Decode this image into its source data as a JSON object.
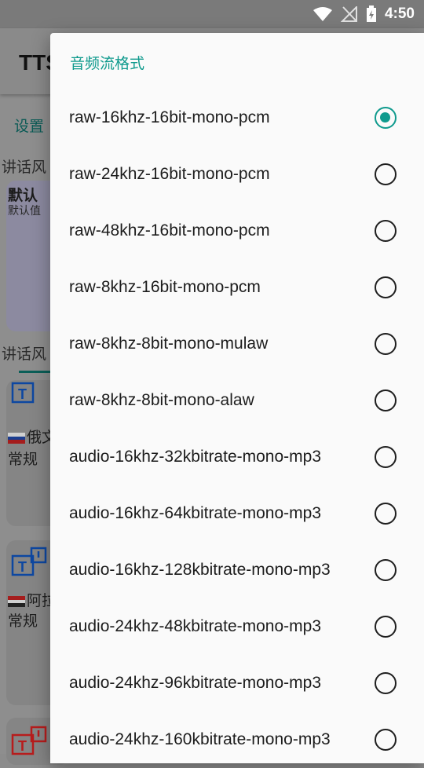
{
  "status_bar": {
    "time": "4:50"
  },
  "background": {
    "title": "TTS",
    "settings_label": "设置",
    "speak_style_label": "讲话风",
    "default_card": {
      "title": "默认",
      "subtitle": "默认值"
    },
    "speak_role_label": "讲话风",
    "voice_cards": [
      {
        "name": "俄文",
        "desc": "常规",
        "flag": "ru",
        "icon_color": "#1565c0"
      },
      {
        "name": "阿拉",
        "desc": "常规",
        "flag": "eg",
        "icon_color": "#1565c0"
      },
      {
        "name": "",
        "desc": "",
        "flag": "",
        "icon_color": "#c62828"
      }
    ]
  },
  "dialog": {
    "title": "音频流格式",
    "options": [
      {
        "label": "raw-16khz-16bit-mono-pcm",
        "checked": true
      },
      {
        "label": "raw-24khz-16bit-mono-pcm",
        "checked": false
      },
      {
        "label": "raw-48khz-16bit-mono-pcm",
        "checked": false
      },
      {
        "label": "raw-8khz-16bit-mono-pcm",
        "checked": false
      },
      {
        "label": "raw-8khz-8bit-mono-mulaw",
        "checked": false
      },
      {
        "label": "raw-8khz-8bit-mono-alaw",
        "checked": false
      },
      {
        "label": "audio-16khz-32kbitrate-mono-mp3",
        "checked": false
      },
      {
        "label": "audio-16khz-64kbitrate-mono-mp3",
        "checked": false
      },
      {
        "label": "audio-16khz-128kbitrate-mono-mp3",
        "checked": false
      },
      {
        "label": "audio-24khz-48kbitrate-mono-mp3",
        "checked": false
      },
      {
        "label": "audio-24khz-96kbitrate-mono-mp3",
        "checked": false
      },
      {
        "label": "audio-24khz-160kbitrate-mono-mp3",
        "checked": false
      }
    ]
  },
  "colors": {
    "accent": "#0f9a8d",
    "scrim": "#8c8c8c"
  }
}
